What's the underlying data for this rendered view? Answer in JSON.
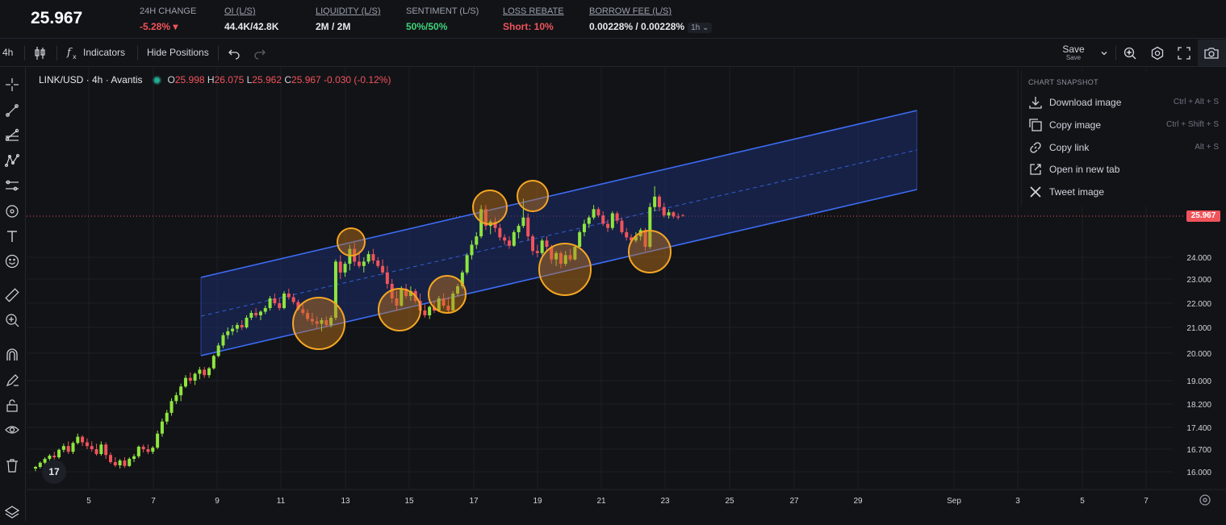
{
  "header": {
    "price": "25.967",
    "stats": [
      {
        "label": "24H CHANGE",
        "value": "-5.28% ▾",
        "tone": "red",
        "underline": false
      },
      {
        "label": "OI (L/S)",
        "value": "44.4K/42.8K",
        "tone": "",
        "underline": true
      },
      {
        "label": "LIQUIDITY (L/S)",
        "value": "2M / 2M",
        "tone": "",
        "underline": true
      },
      {
        "label": "SENTIMENT (L/S)",
        "value": "50%/50%",
        "tone": "green",
        "underline": false
      },
      {
        "label": "LOSS REBATE",
        "value": "Short: 10%",
        "tone": "red",
        "underline": true
      },
      {
        "label": "BORROW FEE (L/S)",
        "value": "0.00228% / 0.00228%",
        "tone": "",
        "underline": true
      }
    ],
    "borrow_interval": "1h"
  },
  "toolbar": {
    "interval": "4h",
    "indicators_label": "Indicators",
    "hide_positions_label": "Hide Positions",
    "save_label": "Save",
    "save_sublabel": "Save"
  },
  "legend": {
    "symbol": "LINK/USD · 4h · Avantis",
    "open_label": "O",
    "open": "25.998",
    "high_label": "H",
    "high": "26.075",
    "low_label": "L",
    "low": "25.962",
    "close_label": "C",
    "close": "25.967",
    "change": "-0.030 (-0.12%)"
  },
  "snapshot_menu": {
    "header": "CHART SNAPSHOT",
    "items": [
      {
        "label": "Download image",
        "shortcut": "Ctrl + Alt + S",
        "icon": "download-icon"
      },
      {
        "label": "Copy image",
        "shortcut": "Ctrl + Shift + S",
        "icon": "copy-icon"
      },
      {
        "label": "Copy link",
        "shortcut": "Alt + S",
        "icon": "link-icon"
      },
      {
        "label": "Open in new tab",
        "shortcut": "",
        "icon": "external-link-icon"
      },
      {
        "label": "Tweet image",
        "shortcut": "",
        "icon": "x-logo-icon"
      }
    ]
  },
  "price_axis": {
    "ticks": [
      "24.000",
      "23.000",
      "22.000",
      "21.000",
      "20.000",
      "19.000",
      "18.200",
      "17.400",
      "16.700",
      "16.000"
    ],
    "current": "25.967"
  },
  "time_axis": {
    "ticks": [
      "5",
      "7",
      "9",
      "11",
      "13",
      "15",
      "17",
      "19",
      "21",
      "23",
      "25",
      "27",
      "29",
      "Sep",
      "3",
      "5",
      "7"
    ]
  },
  "colors": {
    "bg": "#121317",
    "up": "#8ee53f",
    "down": "#f0545b",
    "channel": "#3d6cf5",
    "channel_fill": "#1a2d6b",
    "circle": "#f5a623"
  },
  "chart_data": {
    "type": "candlestick",
    "symbol": "LINK/USD",
    "interval": "4h",
    "candles_ohlc": [
      [
        16.1,
        16.18,
        16.02,
        16.15
      ],
      [
        16.15,
        16.32,
        16.1,
        16.28
      ],
      [
        16.28,
        16.45,
        16.2,
        16.4
      ],
      [
        16.4,
        16.55,
        16.3,
        16.5
      ],
      [
        16.5,
        16.62,
        16.38,
        16.45
      ],
      [
        16.45,
        16.72,
        16.4,
        16.68
      ],
      [
        16.68,
        16.88,
        16.6,
        16.8
      ],
      [
        16.8,
        16.95,
        16.55,
        16.62
      ],
      [
        16.62,
        16.95,
        16.55,
        16.9
      ],
      [
        16.9,
        17.2,
        16.85,
        17.1
      ],
      [
        17.1,
        17.15,
        16.8,
        16.92
      ],
      [
        16.92,
        17.05,
        16.7,
        16.8
      ],
      [
        16.8,
        16.95,
        16.62,
        16.7
      ],
      [
        16.7,
        16.88,
        16.5,
        16.55
      ],
      [
        16.55,
        16.95,
        16.5,
        16.85
      ],
      [
        16.85,
        16.92,
        16.4,
        16.52
      ],
      [
        16.52,
        16.6,
        16.25,
        16.3
      ],
      [
        16.3,
        16.45,
        16.15,
        16.2
      ],
      [
        16.2,
        16.4,
        16.1,
        16.35
      ],
      [
        16.35,
        16.45,
        16.12,
        16.18
      ],
      [
        16.18,
        16.45,
        16.15,
        16.4
      ],
      [
        16.4,
        16.55,
        16.3,
        16.48
      ],
      [
        16.48,
        16.82,
        16.42,
        16.78
      ],
      [
        16.78,
        16.85,
        16.6,
        16.7
      ],
      [
        16.7,
        16.85,
        16.55,
        16.62
      ],
      [
        16.62,
        16.8,
        16.55,
        16.75
      ],
      [
        16.75,
        17.3,
        16.7,
        17.2
      ],
      [
        17.2,
        17.7,
        17.1,
        17.6
      ],
      [
        17.6,
        18.0,
        17.5,
        17.9
      ],
      [
        17.9,
        18.4,
        17.8,
        18.3
      ],
      [
        18.3,
        18.6,
        18.2,
        18.5
      ],
      [
        18.5,
        18.9,
        18.3,
        18.8
      ],
      [
        18.8,
        19.2,
        18.75,
        19.1
      ],
      [
        19.1,
        19.3,
        18.9,
        19.0
      ],
      [
        19.0,
        19.3,
        18.85,
        19.25
      ],
      [
        19.25,
        19.5,
        19.05,
        19.4
      ],
      [
        19.4,
        19.5,
        19.1,
        19.2
      ],
      [
        19.2,
        19.5,
        19.1,
        19.45
      ],
      [
        19.45,
        19.95,
        19.4,
        19.9
      ],
      [
        19.9,
        20.4,
        19.85,
        20.3
      ],
      [
        20.3,
        20.8,
        20.2,
        20.7
      ],
      [
        20.7,
        21.0,
        20.55,
        20.85
      ],
      [
        20.85,
        21.1,
        20.7,
        20.95
      ],
      [
        20.95,
        21.2,
        20.8,
        21.1
      ],
      [
        21.1,
        21.3,
        20.9,
        21.0
      ],
      [
        21.0,
        21.5,
        20.95,
        21.4
      ],
      [
        21.4,
        21.7,
        21.3,
        21.6
      ],
      [
        21.6,
        21.8,
        21.4,
        21.5
      ],
      [
        21.5,
        21.7,
        21.3,
        21.65
      ],
      [
        21.65,
        21.9,
        21.55,
        21.8
      ],
      [
        21.8,
        22.3,
        21.7,
        22.2
      ],
      [
        22.2,
        22.4,
        21.9,
        22.0
      ],
      [
        22.0,
        22.2,
        21.7,
        21.8
      ],
      [
        21.8,
        22.5,
        21.75,
        22.4
      ],
      [
        22.4,
        22.6,
        22.15,
        22.25
      ],
      [
        22.25,
        22.4,
        21.95,
        22.05
      ],
      [
        22.05,
        22.15,
        21.7,
        21.75
      ],
      [
        21.75,
        21.95,
        21.5,
        21.6
      ],
      [
        21.6,
        21.75,
        21.25,
        21.35
      ],
      [
        21.35,
        21.6,
        21.1,
        21.25
      ],
      [
        21.25,
        21.45,
        20.95,
        21.15
      ],
      [
        21.15,
        21.4,
        20.85,
        21.3
      ],
      [
        21.3,
        21.45,
        21.0,
        21.1
      ],
      [
        21.1,
        21.5,
        21.0,
        21.4
      ],
      [
        21.4,
        23.9,
        21.3,
        23.8
      ],
      [
        23.8,
        24.1,
        23.0,
        23.3
      ],
      [
        23.3,
        23.8,
        23.1,
        23.7
      ],
      [
        23.7,
        24.6,
        23.4,
        24.4
      ],
      [
        24.4,
        24.7,
        23.6,
        23.8
      ],
      [
        23.8,
        24.3,
        23.5,
        23.6
      ],
      [
        23.6,
        24.0,
        23.3,
        23.8
      ],
      [
        23.8,
        24.3,
        23.7,
        24.15
      ],
      [
        24.15,
        24.4,
        23.7,
        23.85
      ],
      [
        23.85,
        24.0,
        23.5,
        23.6
      ],
      [
        23.6,
        23.9,
        23.2,
        23.3
      ],
      [
        23.3,
        23.6,
        22.6,
        22.8
      ],
      [
        22.8,
        23.0,
        22.0,
        22.2
      ],
      [
        22.2,
        22.5,
        21.7,
        21.9
      ],
      [
        21.9,
        22.7,
        21.85,
        22.6
      ],
      [
        22.6,
        22.8,
        22.2,
        22.3
      ],
      [
        22.3,
        22.7,
        22.1,
        22.5
      ],
      [
        22.5,
        22.6,
        22.0,
        22.1
      ],
      [
        22.1,
        22.4,
        21.6,
        21.7
      ],
      [
        21.7,
        21.95,
        21.4,
        21.5
      ],
      [
        21.5,
        21.9,
        21.35,
        21.85
      ],
      [
        21.85,
        22.1,
        21.6,
        21.7
      ],
      [
        21.7,
        22.3,
        21.65,
        22.2
      ],
      [
        22.2,
        22.4,
        21.8,
        21.9
      ],
      [
        21.9,
        22.25,
        21.6,
        21.7
      ],
      [
        21.7,
        22.5,
        21.65,
        22.4
      ],
      [
        22.4,
        22.8,
        22.3,
        22.7
      ],
      [
        22.7,
        23.4,
        22.6,
        23.3
      ],
      [
        23.3,
        24.2,
        23.2,
        24.1
      ],
      [
        24.1,
        24.8,
        23.9,
        24.6
      ],
      [
        24.6,
        25.2,
        24.4,
        25.0
      ],
      [
        25.0,
        26.5,
        24.9,
        26.3
      ],
      [
        26.3,
        26.5,
        25.3,
        25.5
      ],
      [
        25.5,
        25.8,
        25.1,
        25.7
      ],
      [
        25.7,
        25.9,
        25.2,
        25.4
      ],
      [
        25.4,
        25.6,
        24.8,
        24.95
      ],
      [
        24.95,
        25.1,
        24.6,
        24.8
      ],
      [
        24.8,
        25.0,
        24.4,
        24.55
      ],
      [
        24.55,
        25.3,
        24.5,
        25.2
      ],
      [
        25.2,
        25.6,
        24.9,
        25.5
      ],
      [
        25.5,
        26.8,
        25.4,
        25.9
      ],
      [
        25.9,
        26.1,
        24.8,
        25.0
      ],
      [
        25.0,
        25.1,
        24.1,
        24.3
      ],
      [
        24.3,
        24.6,
        24.0,
        24.2
      ],
      [
        24.2,
        24.9,
        24.1,
        24.8
      ],
      [
        24.8,
        25.0,
        24.3,
        24.5
      ],
      [
        24.5,
        24.6,
        23.7,
        23.9
      ],
      [
        23.9,
        24.3,
        23.6,
        24.2
      ],
      [
        24.2,
        24.3,
        23.5,
        23.7
      ],
      [
        23.7,
        24.3,
        23.6,
        24.1
      ],
      [
        24.1,
        24.4,
        23.8,
        23.9
      ],
      [
        23.9,
        24.6,
        23.85,
        24.5
      ],
      [
        24.5,
        25.3,
        24.4,
        25.2
      ],
      [
        25.2,
        25.8,
        25.0,
        25.6
      ],
      [
        25.6,
        26.0,
        25.4,
        25.9
      ],
      [
        25.9,
        26.5,
        25.8,
        26.3
      ],
      [
        26.3,
        26.4,
        25.9,
        26.0
      ],
      [
        26.0,
        26.2,
        25.5,
        25.6
      ],
      [
        25.6,
        25.8,
        25.2,
        25.4
      ],
      [
        25.4,
        26.2,
        25.3,
        26.1
      ],
      [
        26.1,
        26.2,
        25.6,
        25.75
      ],
      [
        25.75,
        25.9,
        25.1,
        25.2
      ],
      [
        25.2,
        25.4,
        24.8,
        24.95
      ],
      [
        24.95,
        25.1,
        24.65,
        24.8
      ],
      [
        24.8,
        25.2,
        24.7,
        25.0
      ],
      [
        25.0,
        25.4,
        24.8,
        25.3
      ],
      [
        25.3,
        25.4,
        24.3,
        24.5
      ],
      [
        24.5,
        26.6,
        24.4,
        26.4
      ],
      [
        26.4,
        27.4,
        26.2,
        26.9
      ],
      [
        26.9,
        27.0,
        26.2,
        26.4
      ],
      [
        26.4,
        26.6,
        25.9,
        26.0
      ],
      [
        26.0,
        26.3,
        25.85,
        26.15
      ],
      [
        26.15,
        26.2,
        25.85,
        25.95
      ],
      [
        25.95,
        26.1,
        25.8,
        25.9
      ],
      [
        25.998,
        26.075,
        25.962,
        25.967
      ]
    ]
  }
}
